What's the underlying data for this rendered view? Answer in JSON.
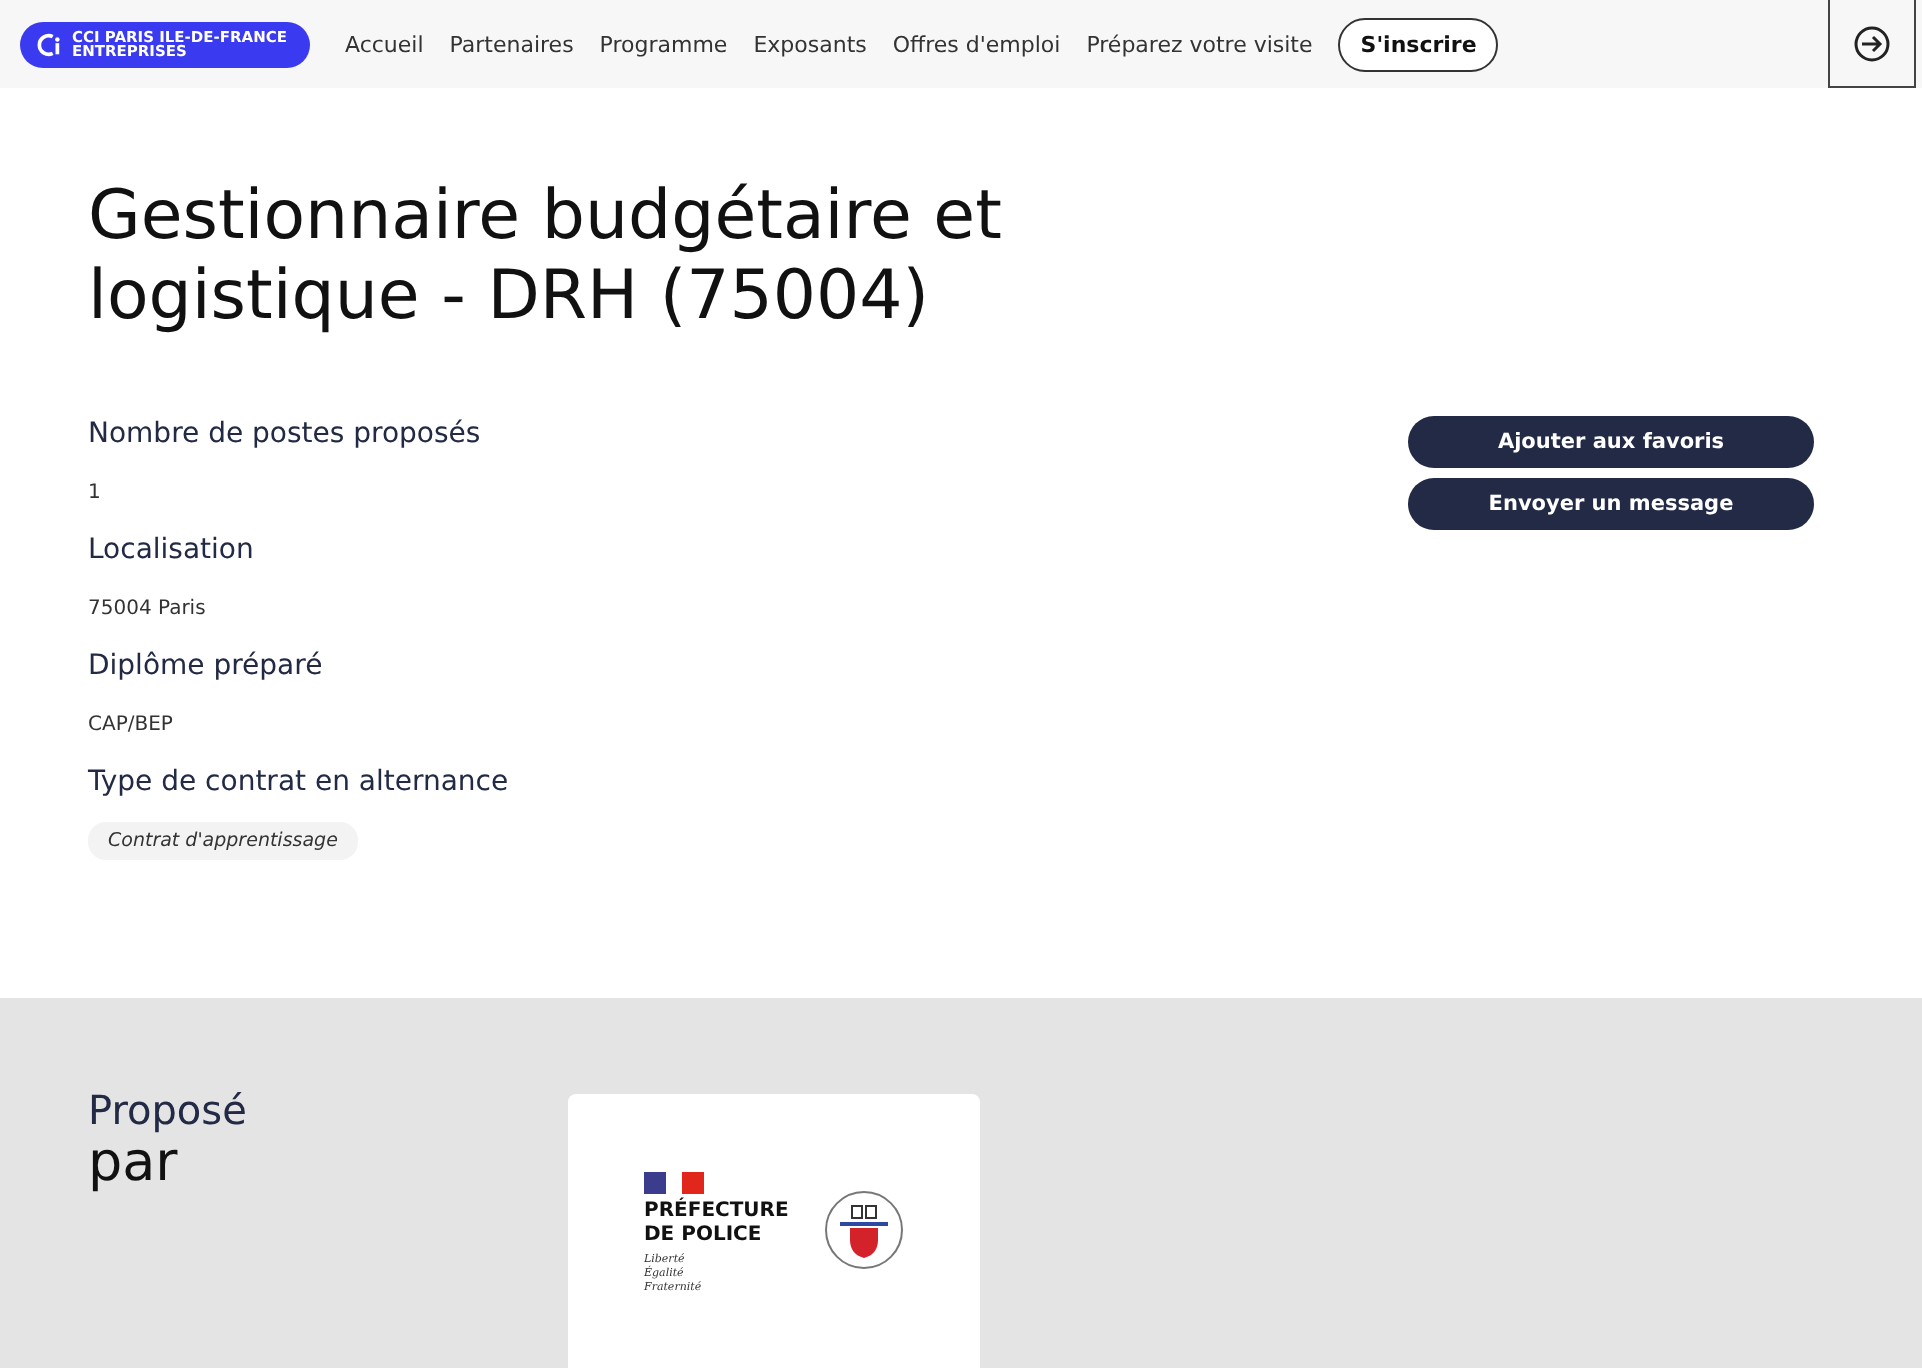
{
  "header": {
    "logo": {
      "line_1": "CCI PARIS ILE-DE-FRANCE",
      "line_2": "ENTREPRISES"
    },
    "nav": [
      "Accueil",
      "Partenaires",
      "Programme",
      "Exposants",
      "Offres d'emploi",
      "Préparez votre visite"
    ],
    "signup": "S'inscrire"
  },
  "job": {
    "title": "Gestionnaire budgétaire et logistique - DRH (75004)",
    "fields": [
      {
        "label": "Nombre de postes proposés",
        "value": "1",
        "kind": "text"
      },
      {
        "label": "Localisation",
        "value": "75004 Paris",
        "kind": "text"
      },
      {
        "label": "Diplôme préparé",
        "value": "CAP/BEP",
        "kind": "text"
      },
      {
        "label": "Type de contrat en alternance",
        "value": "Contrat d'apprentissage",
        "kind": "tag"
      }
    ],
    "actions": [
      "Ajouter aux favoris",
      "Envoyer un message"
    ]
  },
  "offered_by": {
    "heading_1": "Proposé",
    "heading_2": "par",
    "logo": {
      "name_1": "PRÉFECTURE",
      "name_2": "DE POLICE",
      "motto": [
        "Liberté",
        "Égalité",
        "Fraternité"
      ]
    }
  }
}
